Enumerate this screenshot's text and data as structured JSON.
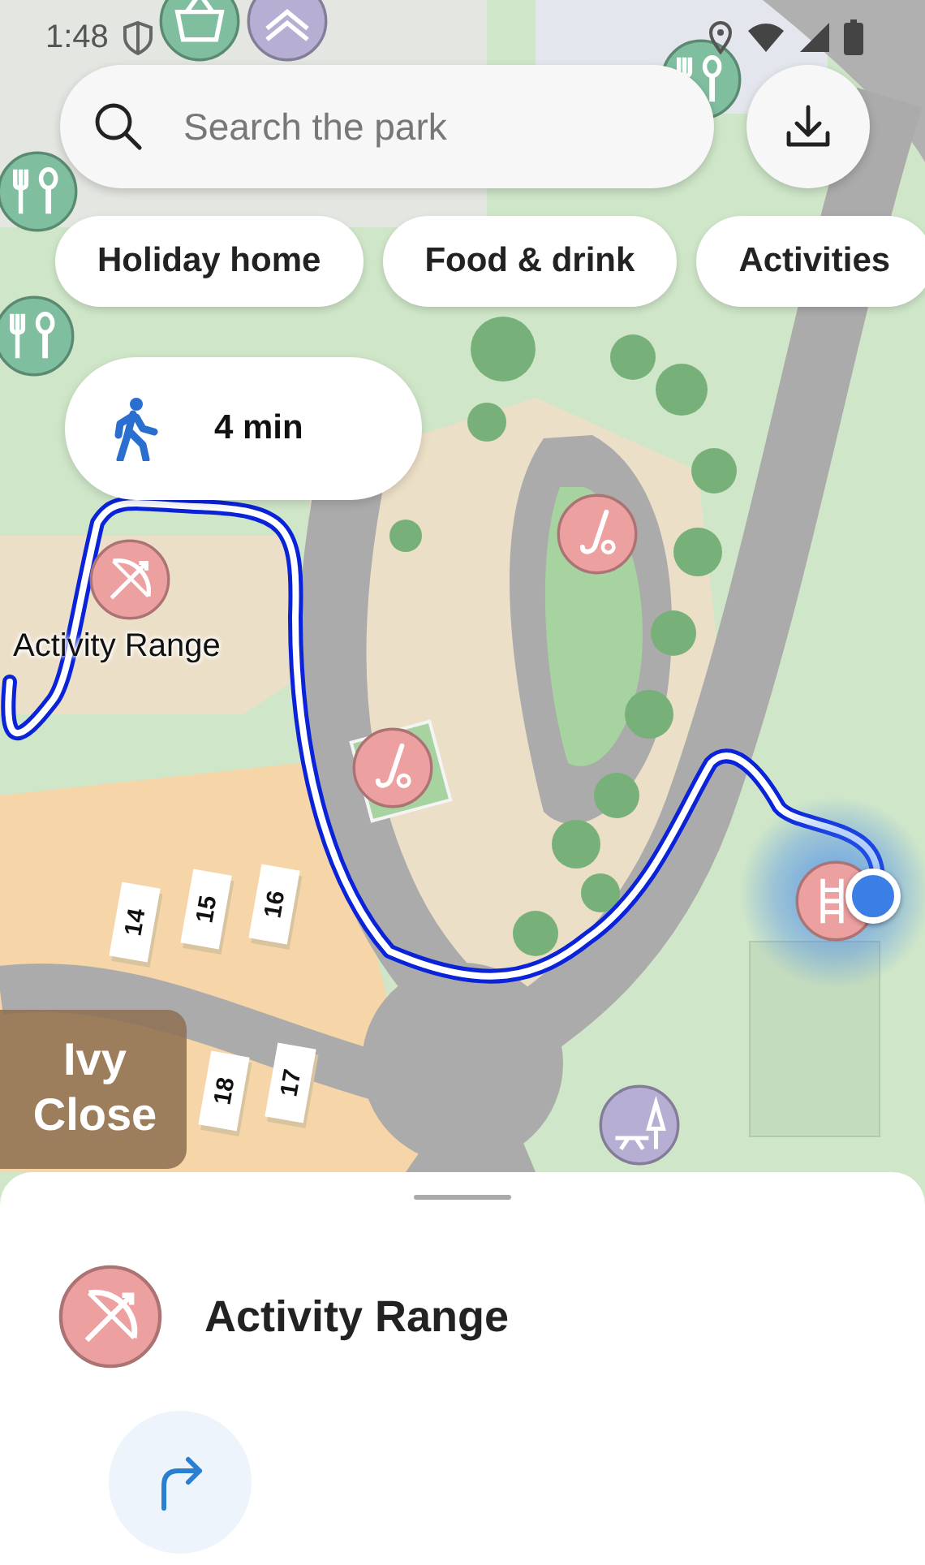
{
  "status_bar": {
    "time": "1:48"
  },
  "search": {
    "placeholder": "Search the park"
  },
  "filter_chips": [
    {
      "label": "Holiday home"
    },
    {
      "label": "Food & drink"
    },
    {
      "label": "Activities"
    }
  ],
  "walk_time": {
    "label": "4 min"
  },
  "map": {
    "pins": [
      {
        "kind": "shop",
        "color": "#7fbf9f"
      },
      {
        "kind": "lodge",
        "color": "#b7aed3"
      },
      {
        "kind": "food",
        "color": "#7fbf9f"
      },
      {
        "kind": "food",
        "color": "#7fbf9f"
      },
      {
        "kind": "food",
        "color": "#7fbf9f"
      },
      {
        "kind": "archery",
        "color": "#eda0a0"
      },
      {
        "kind": "golf",
        "color": "#eda0a0"
      },
      {
        "kind": "golf",
        "color": "#eda0a0"
      },
      {
        "kind": "steps",
        "color": "#eda0a0"
      },
      {
        "kind": "picnic",
        "color": "#b7aed3"
      }
    ],
    "place_label": "Activity Range",
    "area_label": "Ivy Close",
    "plot_numbers": [
      "14",
      "15",
      "16",
      "18",
      "17"
    ]
  },
  "bottom_sheet": {
    "kind": "archery",
    "title": "Activity Range"
  }
}
